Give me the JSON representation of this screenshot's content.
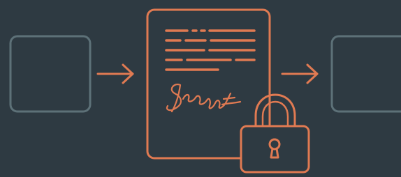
{
  "diagram": {
    "left_box": {
      "icon": "empty-box"
    },
    "arrow_left": {
      "icon": "arrow-right"
    },
    "document": {
      "icon": "signed-document",
      "signature_icon": "handwritten-signature"
    },
    "lock": {
      "icon": "padlock-icon"
    },
    "arrow_right": {
      "icon": "arrow-right"
    },
    "right_box": {
      "icon": "empty-box"
    }
  },
  "colors": {
    "background": "#2e3a42",
    "box_stroke": "#5d7178",
    "accent": "#e07a52"
  }
}
